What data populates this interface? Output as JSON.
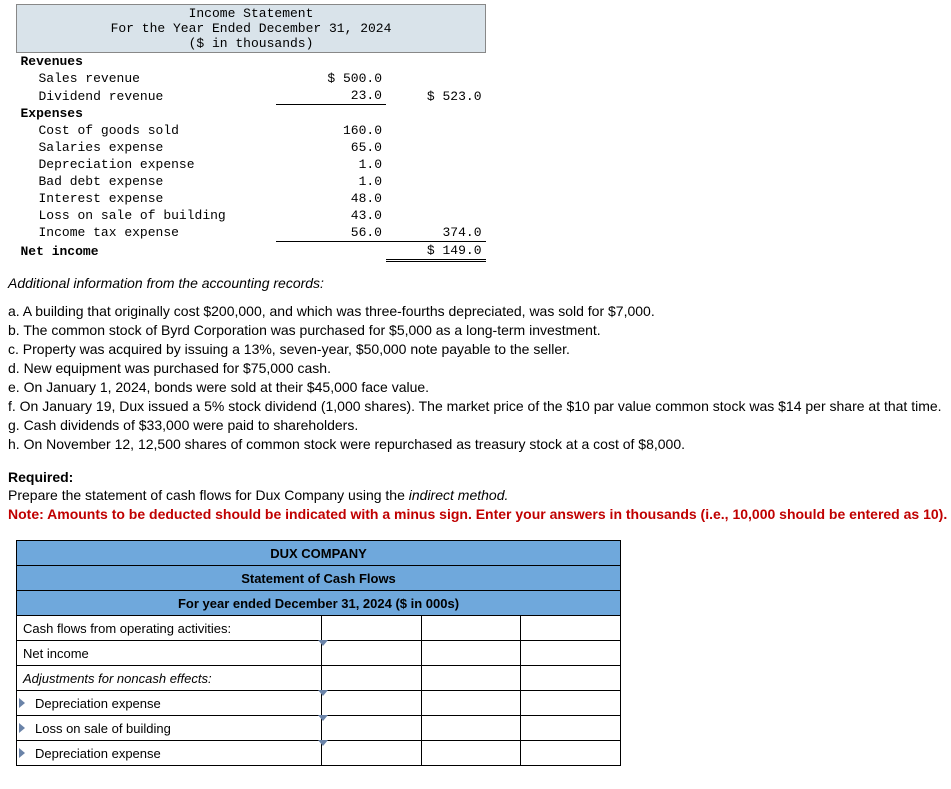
{
  "income_statement": {
    "title_line1": "Income Statement",
    "title_line2": "For the Year Ended December 31, 2024",
    "title_line3": "($ in thousands)",
    "sections": {
      "revenues_hdr": "Revenues",
      "sales_revenue": "Sales revenue",
      "sales_revenue_val": "$ 500.0",
      "dividend_revenue": "Dividend revenue",
      "dividend_revenue_val": "23.0",
      "revenues_total": "$ 523.0",
      "expenses_hdr": "Expenses",
      "cogs": "Cost of goods sold",
      "cogs_val": "160.0",
      "salaries": "Salaries expense",
      "salaries_val": "65.0",
      "depreciation": "Depreciation expense",
      "depreciation_val": "1.0",
      "bad_debt": "Bad debt expense",
      "bad_debt_val": "1.0",
      "interest": "Interest expense",
      "interest_val": "48.0",
      "loss_sale": "Loss on sale of building",
      "loss_sale_val": "43.0",
      "income_tax": "Income tax expense",
      "income_tax_val": "56.0",
      "expenses_total": "374.0",
      "net_income": "Net income",
      "net_income_val": "$ 149.0"
    }
  },
  "additional_info": {
    "heading": "Additional information from the accounting records:",
    "items": [
      "a. A building that originally cost $200,000, and which was three-fourths depreciated, was sold for $7,000.",
      "b. The common stock of Byrd Corporation was purchased for $5,000 as a long-term investment.",
      "c. Property was acquired by issuing a 13%, seven-year, $50,000 note payable to the seller.",
      "d. New equipment was purchased for $75,000 cash.",
      "e. On January 1, 2024, bonds were sold at their $45,000 face value.",
      "f. On January 19, Dux issued a 5% stock dividend (1,000 shares). The market price of the $10 par value common stock was $14 per share at that time.",
      "g. Cash dividends of $33,000 were paid to shareholders.",
      "h. On November 12, 12,500 shares of common stock were repurchased as treasury stock at a cost of $8,000."
    ]
  },
  "required": {
    "heading": "Required:",
    "line1a": "Prepare the statement of cash flows for Dux Company using the ",
    "line1b": "indirect method.",
    "note": "Note: Amounts to be deducted should be indicated with a minus sign. Enter your answers in thousands (i.e., 10,000 should be entered as 10)."
  },
  "answer_table": {
    "hdr1": "DUX COMPANY",
    "hdr2": "Statement of Cash Flows",
    "hdr3": "For year ended December 31, 2024 ($ in 000s)",
    "rows": {
      "r1": "Cash flows from operating activities:",
      "r2": "Net income",
      "r3": "Adjustments for noncash effects:",
      "r4": "Depreciation expense",
      "r5": "Loss on sale of building",
      "r6": "Depreciation expense"
    }
  }
}
